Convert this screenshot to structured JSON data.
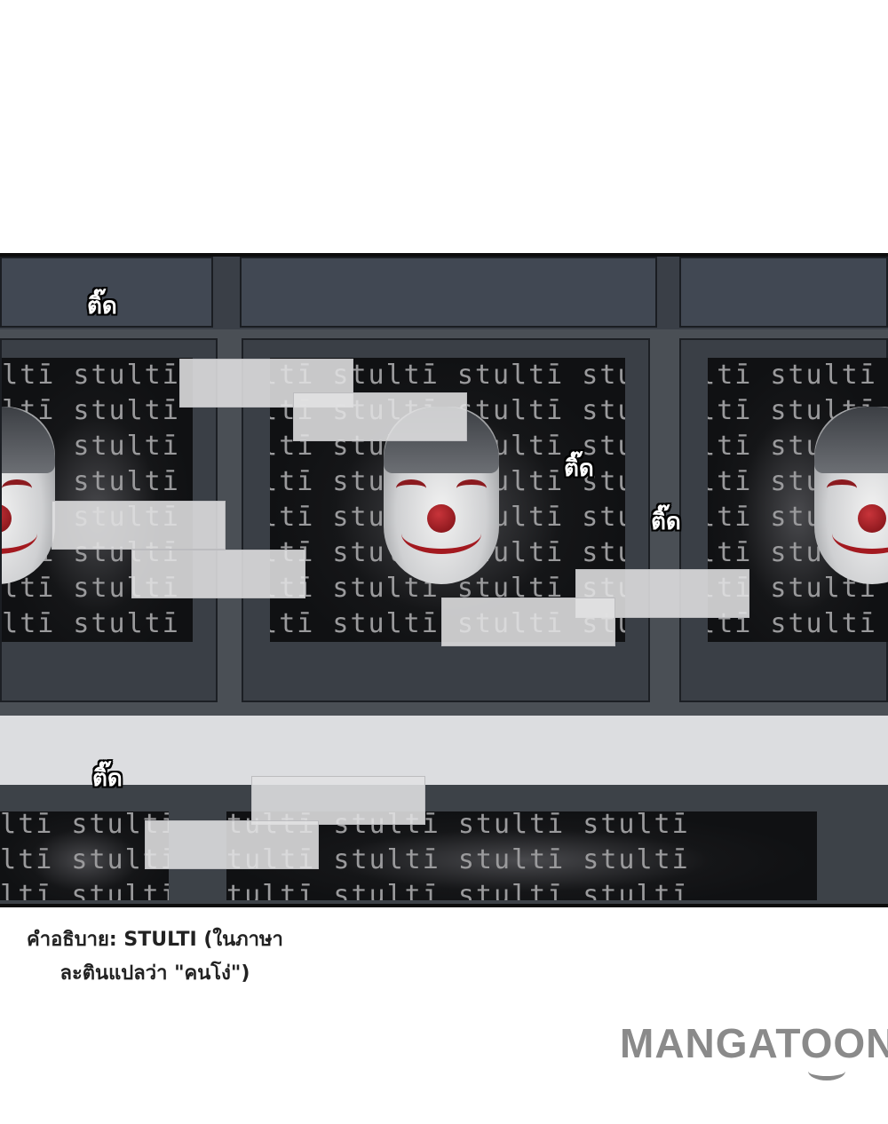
{
  "panel": {
    "screen_text": "stultī stultī stultī stultī",
    "sfx": [
      "ติ๊ด",
      "ติ๊ด",
      "ติ๊ด",
      "ติ๊ด"
    ]
  },
  "caption": {
    "line1": "คำอธิบาย: STULTI (ในภาษา",
    "line2": "ละตินแปลว่า \"คนโง่\")"
  },
  "watermark": {
    "text": "MANGATOON"
  },
  "colors": {
    "mask_red": "#a3191f",
    "panel_dark": "#2b2f35",
    "logo_gray": "#8a8a8a"
  }
}
